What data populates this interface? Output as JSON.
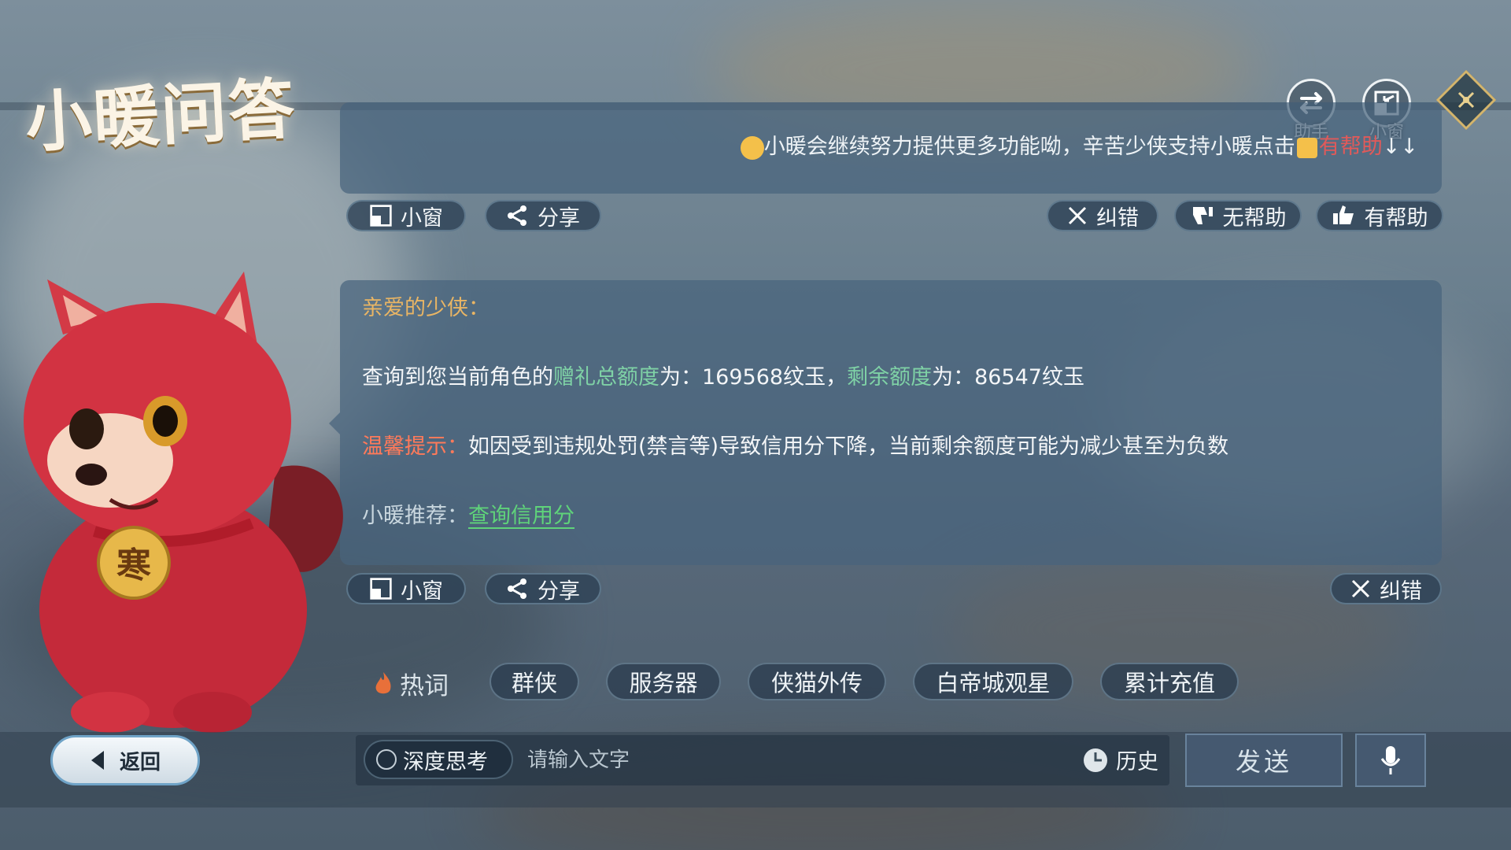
{
  "app": {
    "title": "小暖问答"
  },
  "top_tools": {
    "assistant_label": "助手",
    "mini_window_label": "小窗"
  },
  "notice_panel": {
    "message": "小暖会继续努力提供更多功能呦，辛苦少侠支持小暖点击",
    "helpful_text": "有帮助",
    "arrows": "↓↓"
  },
  "actions_1": {
    "mini_window": "小窗",
    "share": "分享",
    "correct": "纠错",
    "not_helpful": "无帮助",
    "helpful": "有帮助"
  },
  "answer": {
    "greeting": "亲爱的少侠：",
    "query_prefix": "查询到您当前角色的",
    "gift_total_label": "赠礼总额度",
    "query_mid1": "为：169568纹玉，",
    "remaining_label": "剩余额度",
    "query_mid2": "为：86547纹玉",
    "tip_label": "温馨提示：",
    "tip_text": "如因受到违规处罚(禁言等)导致信用分下降，当前剩余额度可能为减少甚至为负数",
    "recommend_label": "小暖推荐：",
    "recommend_link": "查询信用分"
  },
  "actions_2": {
    "mini_window": "小窗",
    "share": "分享",
    "correct": "纠错"
  },
  "hot_words": {
    "label": "热词",
    "items": [
      "群侠",
      "服务器",
      "侠猫外传",
      "白帝城观星",
      "累计充值"
    ]
  },
  "bottom": {
    "back": "返回",
    "deep_think": "深度思考",
    "input_placeholder": "请输入文字",
    "history": "历史",
    "send": "发送"
  },
  "mascot": {
    "badge_text": "寒"
  },
  "colors": {
    "panel": "#48647d",
    "gold_greeting": "#e9b564",
    "highlight_green": "#7fd2a6",
    "tip_red": "#ff7a5a",
    "link_green": "#5fd37a",
    "helpful_red": "#e05a5a"
  }
}
